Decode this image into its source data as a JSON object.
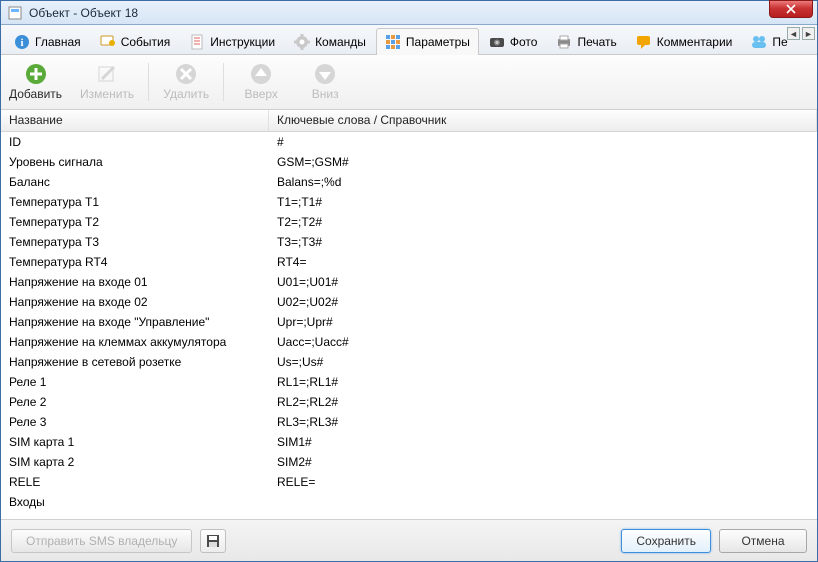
{
  "window": {
    "title": "Объект - Объект 18"
  },
  "tabs": [
    {
      "label": "Главная",
      "icon": "info-icon"
    },
    {
      "label": "События",
      "icon": "flag-icon"
    },
    {
      "label": "Инструкции",
      "icon": "doc-icon"
    },
    {
      "label": "Команды",
      "icon": "gear-icon"
    },
    {
      "label": "Параметры",
      "icon": "grid-icon",
      "active": true
    },
    {
      "label": "Фото",
      "icon": "camera-icon"
    },
    {
      "label": "Печать",
      "icon": "printer-icon"
    },
    {
      "label": "Комментарии",
      "icon": "chat-icon"
    },
    {
      "label": "Пе",
      "icon": "people-icon"
    }
  ],
  "toolbar": {
    "add": "Добавить",
    "edit": "Изменить",
    "delete": "Удалить",
    "up": "Вверх",
    "down": "Вниз"
  },
  "columns": {
    "name": "Название",
    "keywords": "Ключевые слова / Справочник"
  },
  "rows": [
    {
      "name": "ID",
      "kw": "#"
    },
    {
      "name": "Уровень сигнала",
      "kw": "GSM=;GSM#"
    },
    {
      "name": "Баланс",
      "kw": "Balans=;%d"
    },
    {
      "name": "Температура T1",
      "kw": "T1=;T1#"
    },
    {
      "name": "Температура T2",
      "kw": "T2=;T2#"
    },
    {
      "name": "Температура T3",
      "kw": "T3=;T3#"
    },
    {
      "name": "Температура RT4",
      "kw": "RT4="
    },
    {
      "name": "Напряжение на входе 01",
      "kw": "U01=;U01#"
    },
    {
      "name": "Напряжение на входе 02",
      "kw": "U02=;U02#"
    },
    {
      "name": "Напряжение на входе \"Управление\"",
      "kw": "Upr=;Upr#"
    },
    {
      "name": "Напряжение на клеммах аккумулятора",
      "kw": "Uacc=;Uacc#"
    },
    {
      "name": "Напряжение в сетевой розетке",
      "kw": "Us=;Us#"
    },
    {
      "name": "Реле 1",
      "kw": "RL1=;RL1#"
    },
    {
      "name": "Реле 2",
      "kw": "RL2=;RL2#"
    },
    {
      "name": "Реле 3",
      "kw": "RL3=;RL3#"
    },
    {
      "name": "SIM карта 1",
      "kw": "SIM1#"
    },
    {
      "name": "SIM карта 2",
      "kw": "SIM2#"
    },
    {
      "name": "RELE",
      "kw": "RELE="
    },
    {
      "name": "Входы",
      "kw": ""
    }
  ],
  "footer": {
    "send_sms": "Отправить SMS владельцу",
    "save": "Сохранить",
    "cancel": "Отмена"
  }
}
